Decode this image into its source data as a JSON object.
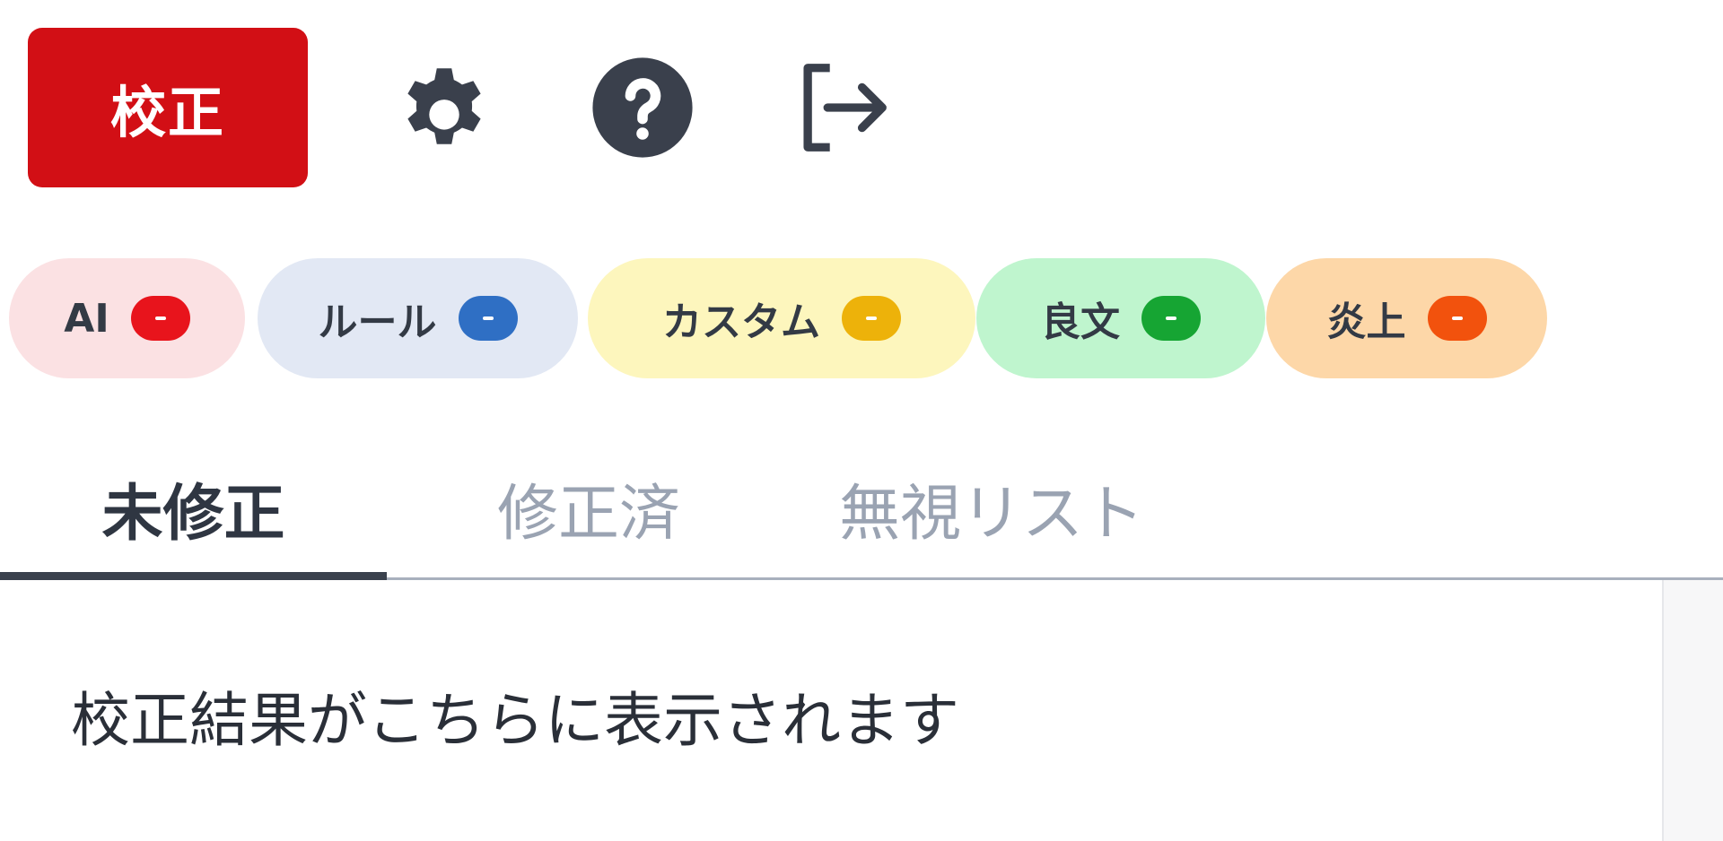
{
  "colors": {
    "primary": "#d20f15",
    "icon": "#3a404c",
    "tab_active": "#2f3642",
    "tab_inactive": "#9aa3b2"
  },
  "toolbar": {
    "proofread_label": "校正",
    "icons": [
      "gear-icon",
      "help-icon",
      "logout-icon"
    ]
  },
  "chips": [
    {
      "label": "AI",
      "bg": "#fbe1e3",
      "dot": "#e8141c"
    },
    {
      "label": "ルール",
      "bg": "#e2e8f4",
      "dot": "#2f6fc4"
    },
    {
      "label": "カスタム",
      "bg": "#fdf6bd",
      "dot": "#edb20a"
    },
    {
      "label": "良文",
      "bg": "#bff5ce",
      "dot": "#16a533"
    },
    {
      "label": "炎上",
      "bg": "#fdd7a8",
      "dot": "#f2520d"
    }
  ],
  "tabs": [
    {
      "label": "未修正",
      "active": true
    },
    {
      "label": "修正済",
      "active": false
    },
    {
      "label": "無視リスト",
      "active": false
    }
  ],
  "content": {
    "placeholder": "校正結果がこちらに表示されます"
  }
}
